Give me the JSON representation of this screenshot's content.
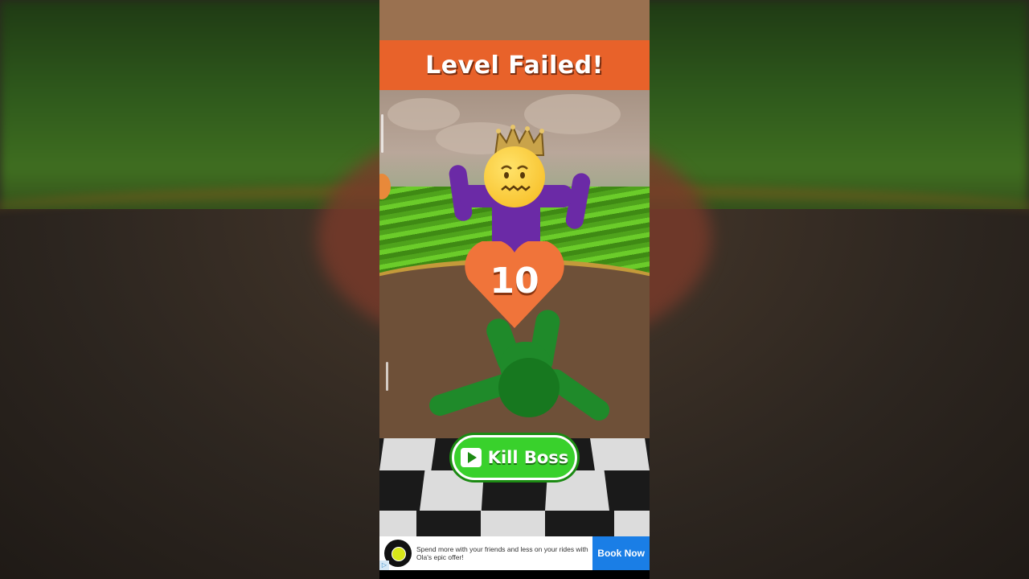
{
  "banner": {
    "title": "Level Failed!"
  },
  "boss": {
    "health": "10"
  },
  "actions": {
    "kill_boss_label": "Kill Boss"
  },
  "ad": {
    "text": "Spend more with your friends and less on your rides with Ola's epic offer!",
    "cta_label": "Book Now",
    "choices_icon": "▷"
  },
  "colors": {
    "banner": "#e8622a",
    "button": "#39d12c",
    "heart": "#f0743a",
    "boss": "#6b2aa6",
    "player": "#1f8a2a",
    "ad_cta": "#1a7ee6"
  },
  "icons": [
    "play-icon",
    "crown-icon",
    "heart-icon",
    "worried-emoji-icon",
    "ad-logo-icon"
  ]
}
